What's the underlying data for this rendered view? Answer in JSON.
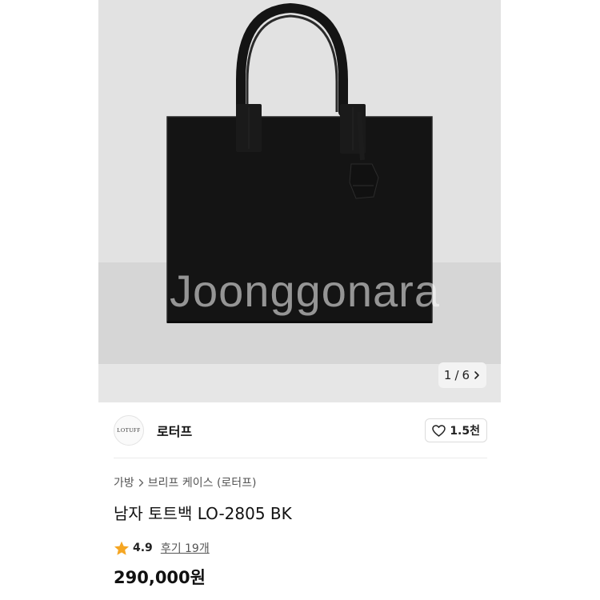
{
  "gallery": {
    "watermark": "Joonggonara",
    "pager": {
      "current": "1",
      "separator": "/",
      "total": "6"
    }
  },
  "seller": {
    "avatar_text": "LOTUFF",
    "name": "로터프",
    "like_count": "1.5천"
  },
  "breadcrumb": {
    "category": "가방",
    "subcategory": "브리프 케이스 (로터프)"
  },
  "product": {
    "title": "남자 토트백 LO-2805 BK",
    "rating": "4.9",
    "review_label": "후기 19개",
    "price": "290,000원"
  },
  "icons": {
    "pager_next": "chevron-right-icon",
    "like": "heart-outline-icon",
    "breadcrumb_separator": "chevron-right-icon",
    "rating": "star-icon"
  },
  "colors": {
    "star": "#f5a623",
    "image_background": "#e2e2e2",
    "bag": "#141414"
  }
}
